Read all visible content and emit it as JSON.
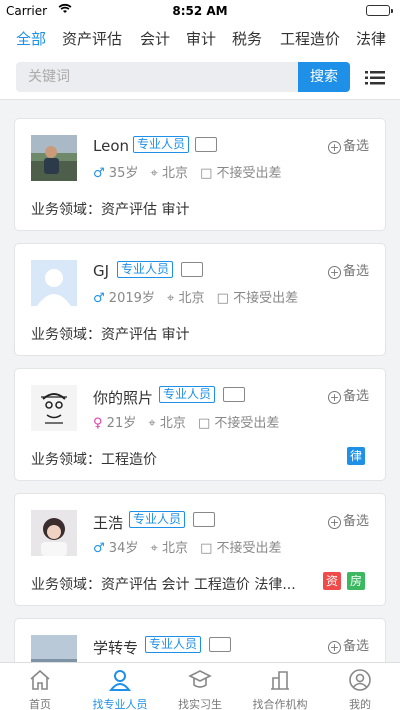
{
  "status_bar": {
    "carrier": "Carrier",
    "time": "8:52 AM"
  },
  "tabs": [
    "全部",
    "资产评估",
    "会计",
    "审计",
    "税务",
    "工程造价",
    "法律"
  ],
  "search": {
    "placeholder": "关键词",
    "button": "搜索"
  },
  "cards": [
    {
      "name": "Leon",
      "tag": "专业人员",
      "sex": "♂",
      "age": "35岁",
      "city": "北京",
      "travel": "不接受出差",
      "field": "业务领域：资产评估 审计",
      "backup": "备选",
      "badges": []
    },
    {
      "name": "GJ",
      "tag": "专业人员",
      "sex": "♂",
      "age": "2019岁",
      "city": "北京",
      "travel": "不接受出差",
      "field": "业务领域：资产评估 审计",
      "backup": "备选",
      "badges": []
    },
    {
      "name": "你的照片",
      "tag": "专业人员",
      "sex": "♀",
      "age": "21岁",
      "city": "北京",
      "travel": "不接受出差",
      "field": "业务领域：工程造价",
      "backup": "备选",
      "badges": [
        {
          "text": "律",
          "color": "#1e90e8"
        }
      ]
    },
    {
      "name": "王浩",
      "tag": "专业人员",
      "sex": "♂",
      "age": "34岁",
      "city": "北京",
      "travel": "不接受出差",
      "field": "业务领域：资产评估 会计 工程造价 法律...",
      "backup": "备选",
      "badges": [
        {
          "text": "资",
          "color": "#ef4b4b"
        },
        {
          "text": "房",
          "color": "#3cb861"
        }
      ]
    },
    {
      "name": "学转专",
      "tag": "专业人员",
      "sex": "",
      "age": "",
      "city": "",
      "travel": "",
      "field": "",
      "backup": "备选",
      "badges": []
    }
  ],
  "bottom_nav": [
    {
      "label": "首页",
      "icon": "home-icon",
      "active": false
    },
    {
      "label": "找专业人员",
      "icon": "person-icon",
      "active": true
    },
    {
      "label": "找实习生",
      "icon": "graduation-cap-icon",
      "active": false
    },
    {
      "label": "找合作机构",
      "icon": "building-icon",
      "active": false
    },
    {
      "label": "我的",
      "icon": "profile-icon",
      "active": false
    }
  ],
  "colors": {
    "accent": "#1e90e8",
    "female": "#e040a8",
    "badge_red": "#ef4b4b",
    "badge_green": "#3cb861"
  }
}
